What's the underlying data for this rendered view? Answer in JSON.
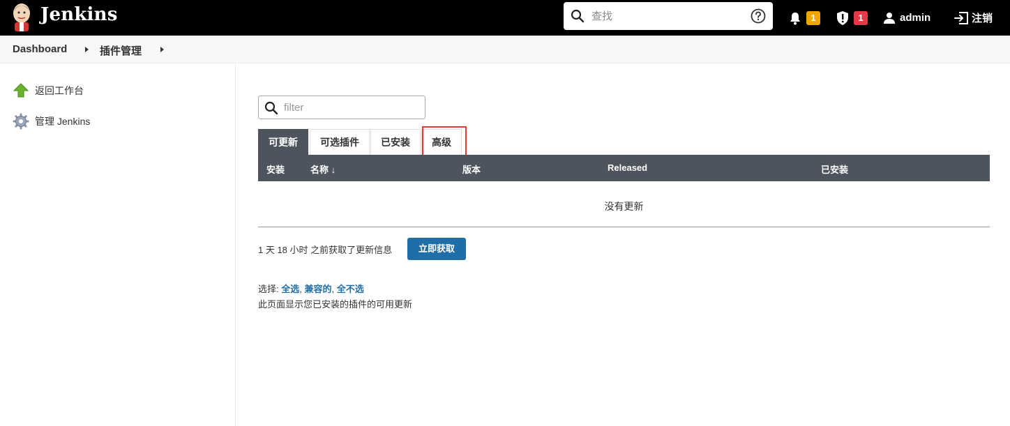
{
  "header": {
    "brand": "Jenkins",
    "search_placeholder": "查找",
    "notifications_count": "1",
    "security_count": "1",
    "user": "admin",
    "logout_label": "注销"
  },
  "breadcrumb": [
    "Dashboard",
    "插件管理"
  ],
  "sidebar": {
    "items": [
      {
        "label": "返回工作台",
        "icon": "up-arrow-icon"
      },
      {
        "label": "管理 Jenkins",
        "icon": "gear-icon"
      }
    ]
  },
  "main": {
    "filter_placeholder": "filter",
    "tabs": [
      {
        "label": "可更新",
        "active": true
      },
      {
        "label": "可选插件",
        "active": false
      },
      {
        "label": "已安装",
        "active": false
      },
      {
        "label": "高级",
        "active": false
      }
    ],
    "table": {
      "columns": [
        "安装",
        "名称 ↓",
        "版本",
        "Released",
        "已安装"
      ],
      "empty_text": "没有更新"
    },
    "last_check": "1 天 18 小时 之前获取了更新信息",
    "fetch_button": "立即获取",
    "select_prefix": "选择:",
    "select_links": [
      "全选",
      "兼容的",
      "全不选"
    ],
    "description": "此页面显示您已安装的插件的可用更新"
  },
  "colors": {
    "header_bg": "#000000",
    "table_header_bg": "#4d545d",
    "button_blue": "#1f6ea8",
    "badge_orange": "#f0a500",
    "badge_red": "#e63946",
    "highlight_red": "#e53935"
  }
}
